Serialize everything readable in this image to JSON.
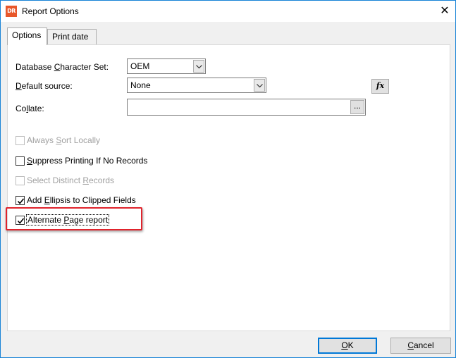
{
  "window": {
    "title": "Report Options",
    "icon_text": "DR",
    "close_glyph": "✕"
  },
  "tabs": [
    {
      "label": "Options",
      "active": true
    },
    {
      "label": "Print date",
      "active": false
    }
  ],
  "options": {
    "db_charset": {
      "label_pre": "Database ",
      "label_ul": "C",
      "label_post": "haracter Set:",
      "value": "OEM"
    },
    "default_source": {
      "label_pre": "",
      "label_ul": "D",
      "label_post": "efault source:",
      "value": "None"
    },
    "collate": {
      "label_pre": "Co",
      "label_ul": "l",
      "label_post": "late:",
      "value": "",
      "button": "..."
    },
    "fx_button": "fx",
    "checkboxes": [
      {
        "pre": "Always ",
        "ul": "S",
        "post": "ort Locally",
        "checked": false,
        "disabled": true
      },
      {
        "pre": "",
        "ul": "S",
        "post": "uppress Printing If No Records",
        "checked": false,
        "disabled": false
      },
      {
        "pre": "Select Distinct ",
        "ul": "R",
        "post": "ecords",
        "checked": false,
        "disabled": true
      },
      {
        "pre": "Add ",
        "ul": "E",
        "post": "llipsis to Clipped Fields",
        "checked": true,
        "disabled": false
      },
      {
        "pre": "Alternate ",
        "ul": "P",
        "post": "age report",
        "checked": true,
        "disabled": false
      }
    ]
  },
  "footer": {
    "ok_ul": "O",
    "ok_post": "K",
    "cancel_ul": "C",
    "cancel_post": "ancel"
  },
  "colors": {
    "accent": "#0078d7",
    "highlight": "#e0232c",
    "icon_bg": "#e8572a"
  }
}
